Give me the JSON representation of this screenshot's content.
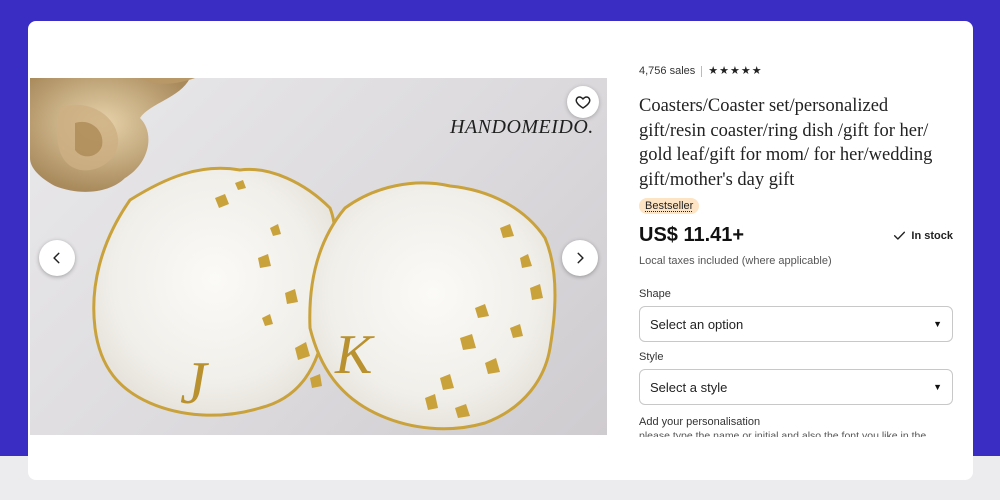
{
  "listing": {
    "sales": "4,756 sales",
    "rating_stars": 5,
    "title": "Coasters/Coaster set/personalized gift/resin coaster/ring dish /gift for her/ gold leaf/gift for mom/ for her/wedding gift/mother's day gift",
    "badge": "Bestseller",
    "price": "US$ 11.41+",
    "stock": "In stock",
    "tax_note": "Local taxes included (where applicable)"
  },
  "photo": {
    "watermark": "HANDOMEIDO.",
    "coaster_letters": [
      "J",
      "K"
    ]
  },
  "options": {
    "shape": {
      "label": "Shape",
      "selected": "Select an option"
    },
    "style": {
      "label": "Style",
      "selected": "Select a style"
    }
  },
  "personalisation": {
    "label": "Add your personalisation",
    "description": "please type the name or initial and also the font you like in the"
  },
  "icons": {
    "favorite": "heart-icon",
    "previous": "chevron-left-icon",
    "next": "chevron-right-icon",
    "stock": "checkmark-icon",
    "dropdown": "caret-down-icon",
    "rating": "star-icon"
  },
  "colors": {
    "page_background": "#3a2dc4",
    "badge_background": "#fde4c4",
    "gold": "#c9a23c"
  }
}
